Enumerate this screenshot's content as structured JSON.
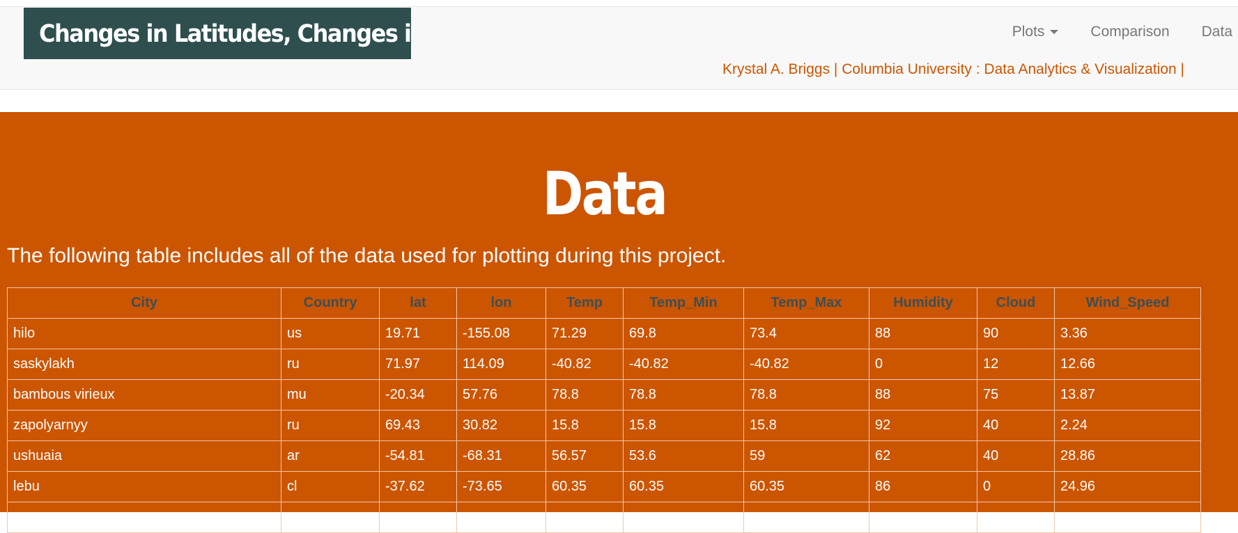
{
  "header": {
    "brand": "Changes in Latitudes, Changes in ...",
    "nav": [
      {
        "label": "Plots",
        "has_dropdown": true
      },
      {
        "label": "Comparison",
        "has_dropdown": false
      },
      {
        "label": "Data",
        "has_dropdown": false
      }
    ],
    "byline": "Krystal A. Briggs | Columbia University : Data Analytics & Visualization |"
  },
  "main": {
    "title": "Data",
    "intro": "The following table includes all of the data used for plotting during this project.",
    "table": {
      "columns": [
        "City",
        "Country",
        "lat",
        "lon",
        "Temp",
        "Temp_Min",
        "Temp_Max",
        "Humidity",
        "Cloud",
        "Wind_Speed"
      ],
      "rows": [
        [
          "hilo",
          "us",
          "19.71",
          "-155.08",
          "71.29",
          "69.8",
          "73.4",
          "88",
          "90",
          "3.36"
        ],
        [
          "saskylakh",
          "ru",
          "71.97",
          "114.09",
          "-40.82",
          "-40.82",
          "-40.82",
          "0",
          "12",
          "12.66"
        ],
        [
          "bambous virieux",
          "mu",
          "-20.34",
          "57.76",
          "78.8",
          "78.8",
          "78.8",
          "88",
          "75",
          "13.87"
        ],
        [
          "zapolyarnyy",
          "ru",
          "69.43",
          "30.82",
          "15.8",
          "15.8",
          "15.8",
          "92",
          "40",
          "2.24"
        ],
        [
          "ushuaia",
          "ar",
          "-54.81",
          "-68.31",
          "56.57",
          "53.6",
          "59",
          "62",
          "40",
          "28.86"
        ],
        [
          "lebu",
          "cl",
          "-37.62",
          "-73.65",
          "60.35",
          "60.35",
          "60.35",
          "86",
          "0",
          "24.96"
        ],
        [
          "",
          "",
          "",
          "",
          "",
          "",
          "",
          "",
          "",
          ""
        ]
      ]
    }
  },
  "colors": {
    "accent": "#cc5500",
    "brand_bg": "#2f4f4f",
    "header_text": "#3d4f55",
    "nav_text": "#777777"
  }
}
